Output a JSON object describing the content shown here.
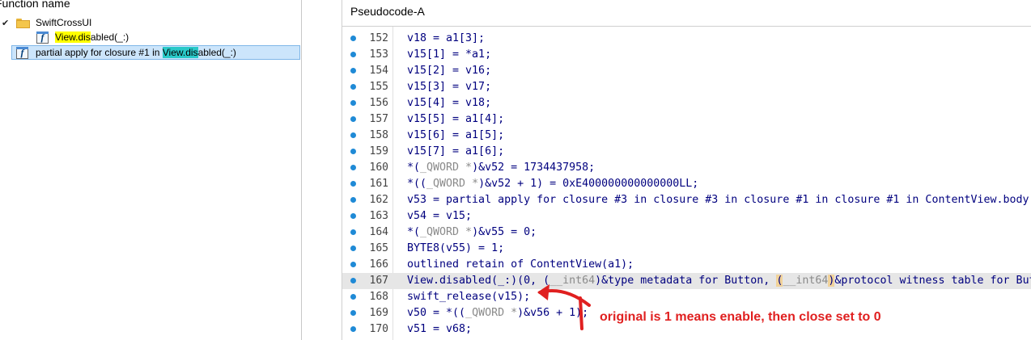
{
  "functions_panel": {
    "header": "Function name",
    "tree": {
      "group_label": "SwiftCrossUI",
      "items": [
        {
          "prefix": "",
          "highlight": "View.dis",
          "suffix": "abled(_:)"
        },
        {
          "prefix": "partial apply for closure #1 in ",
          "highlight": "View.dis",
          "suffix": "abled(_:)"
        }
      ]
    }
  },
  "pseudocode": {
    "title": "Pseudocode-A",
    "lines": [
      {
        "no": "152",
        "text": "v18 = a1[3];"
      },
      {
        "no": "153",
        "text": "v15[1] = *a1;"
      },
      {
        "no": "154",
        "text": "v15[2] = v16;"
      },
      {
        "no": "155",
        "text": "v15[3] = v17;"
      },
      {
        "no": "156",
        "text": "v15[4] = v18;"
      },
      {
        "no": "157",
        "text": "v15[5] = a1[4];"
      },
      {
        "no": "158",
        "text": "v15[6] = a1[5];"
      },
      {
        "no": "159",
        "text": "v15[7] = a1[6];"
      },
      {
        "no": "160",
        "pre": "*(",
        "gray": "_QWORD *",
        "post": ")&v52 = 1734437958;"
      },
      {
        "no": "161",
        "pre": "*((",
        "gray": "_QWORD *",
        "post": ")&v52 + 1) = 0xE400000000000000LL;"
      },
      {
        "no": "162",
        "text": "v53 = partial apply for closure #3 in closure #3 in closure #1 in closure #1 in ContentView.body.getter;"
      },
      {
        "no": "163",
        "text": "v54 = v15;"
      },
      {
        "no": "164",
        "pre": "*(",
        "gray": "_QWORD *",
        "post": ")&v55 = 0;"
      },
      {
        "no": "165",
        "text": "BYTE8(v55) = 1;"
      },
      {
        "no": "166",
        "text": "outlined retain of ContentView(a1);"
      },
      {
        "no": "167",
        "pre": "View.disabled(_:)(0, (",
        "gray": "__int64",
        "mid": ")&type metadata for Button, ",
        "hl": "(",
        "gray2": "__int64",
        "hl2": ")",
        "post": "&protocol witness table for Button);"
      },
      {
        "no": "168",
        "text": "swift_release(v15);"
      },
      {
        "no": "169",
        "pre": "v50 = *((",
        "gray": "_QWORD *",
        "post": ")&v56 + 1);"
      },
      {
        "no": "170",
        "text": "v51 = v68;"
      }
    ],
    "current_line": "167"
  },
  "annotation": {
    "text": "original is 1 means enable, then close set to 0",
    "color": "#e02020"
  }
}
